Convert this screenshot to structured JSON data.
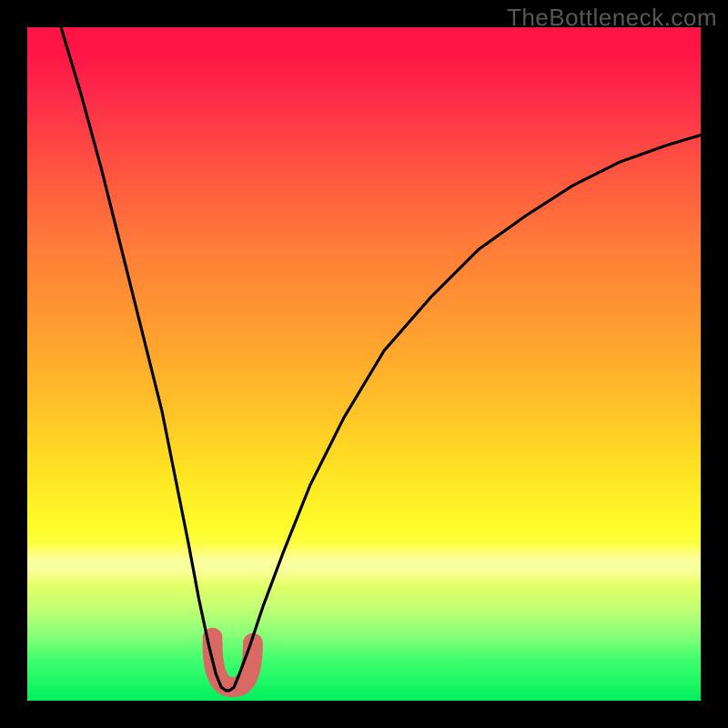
{
  "watermark": "TheBottleneck.com",
  "colors": {
    "background": "#000000",
    "watermark": "#575757",
    "curve_stroke": "#000000",
    "bump_fill": "#d86a63",
    "gradient_top": "#ff1446",
    "gradient_bottom": "#00ef5e"
  },
  "chart_data": {
    "type": "line",
    "title": "",
    "xlabel": "",
    "ylabel": "",
    "xlim": [
      0,
      100
    ],
    "ylim": [
      0,
      100
    ],
    "x": [
      5,
      8,
      11,
      14,
      17,
      20,
      22,
      24,
      25.5,
      27,
      28,
      28.8,
      29.5,
      30,
      30.7,
      31.5,
      33,
      35,
      38,
      42,
      47,
      53,
      60,
      67,
      74,
      81,
      88,
      95,
      100
    ],
    "values": [
      100,
      90,
      79,
      67,
      55,
      43,
      33,
      23,
      15,
      8,
      4,
      2,
      1.5,
      1.5,
      2,
      4,
      8,
      14,
      22,
      32,
      42,
      52,
      60,
      67,
      72,
      76.5,
      80,
      82.5,
      84
    ],
    "series": [
      {
        "name": "bottleneck-curve",
        "x": [
          5,
          8,
          11,
          14,
          17,
          20,
          22,
          24,
          25.5,
          27,
          28,
          28.8,
          29.5,
          30,
          30.7,
          31.5,
          33,
          35,
          38,
          42,
          47,
          53,
          60,
          67,
          74,
          81,
          88,
          95,
          100
        ],
        "y": [
          100,
          90,
          79,
          67,
          55,
          43,
          33,
          23,
          15,
          8,
          4,
          2,
          1.5,
          1.5,
          2,
          4,
          8,
          14,
          22,
          32,
          42,
          52,
          60,
          67,
          72,
          76.5,
          80,
          82.5,
          84
        ]
      }
    ],
    "marker": {
      "name": "optimal-range",
      "shape": "u-bump",
      "x_range": [
        27.5,
        33.5
      ],
      "y_level": 2
    }
  }
}
